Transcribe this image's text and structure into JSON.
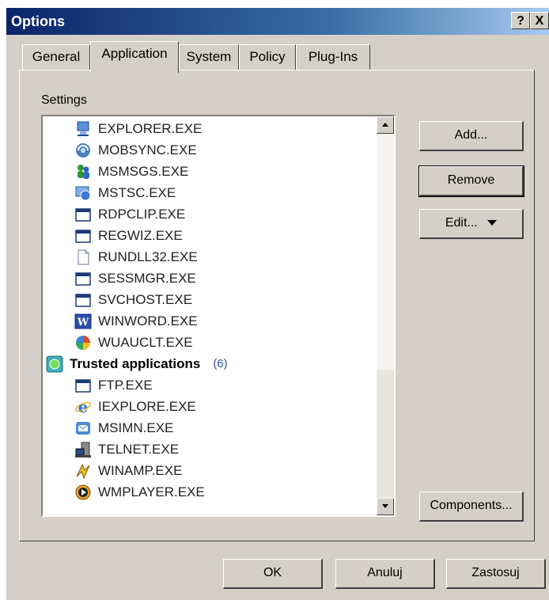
{
  "window": {
    "title": "Options",
    "help_label": "?",
    "close_label": "X"
  },
  "tabs": [
    {
      "label": "General"
    },
    {
      "label": "Application",
      "active": true
    },
    {
      "label": "System"
    },
    {
      "label": "Policy"
    },
    {
      "label": "Plug-Ins"
    }
  ],
  "settings_label": "Settings",
  "list": {
    "items": [
      {
        "label": "EXPLORER.EXE",
        "icon": "explorer-icon"
      },
      {
        "label": "MOBSYNC.EXE",
        "icon": "mobsync-icon"
      },
      {
        "label": "MSMSGS.EXE",
        "icon": "msn-messenger-icon"
      },
      {
        "label": "MSTSC.EXE",
        "icon": "remote-desktop-icon"
      },
      {
        "label": "RDPCLIP.EXE",
        "icon": "window-icon"
      },
      {
        "label": "REGWIZ.EXE",
        "icon": "window-icon"
      },
      {
        "label": "RUNDLL32.EXE",
        "icon": "document-icon"
      },
      {
        "label": "SESSMGR.EXE",
        "icon": "window-icon"
      },
      {
        "label": "SVCHOST.EXE",
        "icon": "window-icon"
      },
      {
        "label": "WINWORD.EXE",
        "icon": "word-icon"
      },
      {
        "label": "WUAUCLT.EXE",
        "icon": "windows-update-icon"
      },
      {
        "label": "Trusted applications",
        "icon": "trusted-group-icon",
        "group": true,
        "count": "(6)"
      },
      {
        "label": "FTP.EXE",
        "icon": "window-icon"
      },
      {
        "label": "IEXPLORE.EXE",
        "icon": "internet-explorer-icon"
      },
      {
        "label": "MSIMN.EXE",
        "icon": "outlook-express-icon"
      },
      {
        "label": "TELNET.EXE",
        "icon": "telnet-icon"
      },
      {
        "label": "WINAMP.EXE",
        "icon": "winamp-icon"
      },
      {
        "label": "WMPLAYER.EXE",
        "icon": "media-player-icon"
      }
    ]
  },
  "buttons": {
    "add": "Add...",
    "remove": "Remove",
    "edit": "Edit...",
    "components": "Components...",
    "ok": "OK",
    "cancel": "Anuluj",
    "apply": "Zastosuj"
  },
  "colors": {
    "title_start": "#0a246a",
    "title_end": "#a6caf0",
    "face": "#d4d0c8"
  }
}
